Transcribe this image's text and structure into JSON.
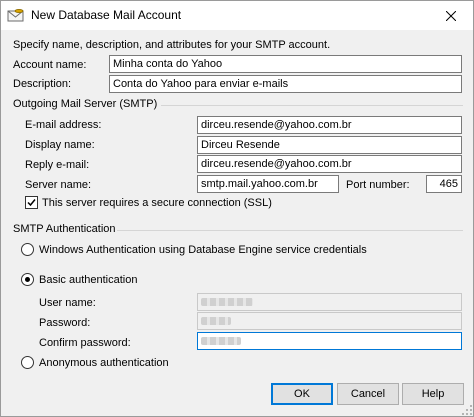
{
  "window": {
    "title": "New Database Mail Account",
    "icon": "database-mail-icon"
  },
  "intro": "Specify name, description, and attributes for your SMTP account.",
  "account": {
    "name_label": "Account name:",
    "name_value": "Minha conta do Yahoo",
    "description_label": "Description:",
    "description_value": "Conta do Yahoo para enviar e-mails"
  },
  "smtp": {
    "group_label": "Outgoing Mail Server (SMTP)",
    "email_label": "E-mail address:",
    "email_value": "dirceu.resende@yahoo.com.br",
    "display_label": "Display name:",
    "display_value": "Dirceu Resende",
    "reply_label": "Reply e-mail:",
    "reply_value": "dirceu.resende@yahoo.com.br",
    "server_label": "Server name:",
    "server_value": "smtp.mail.yahoo.com.br",
    "port_label": "Port number:",
    "port_value": "465",
    "ssl_label": "This server requires a secure connection (SSL)",
    "ssl_checked": true
  },
  "auth": {
    "group_label": "SMTP Authentication",
    "windows_label": "Windows Authentication using Database Engine service credentials",
    "basic_label": "Basic authentication",
    "username_label": "User name:",
    "password_label": "Password:",
    "confirm_label": "Confirm password:",
    "anonymous_label": "Anonymous authentication",
    "selected": "basic"
  },
  "buttons": {
    "ok": "OK",
    "cancel": "Cancel",
    "help": "Help"
  },
  "colors": {
    "accent": "#0078d7",
    "window_bg": "#f0f0f0"
  }
}
